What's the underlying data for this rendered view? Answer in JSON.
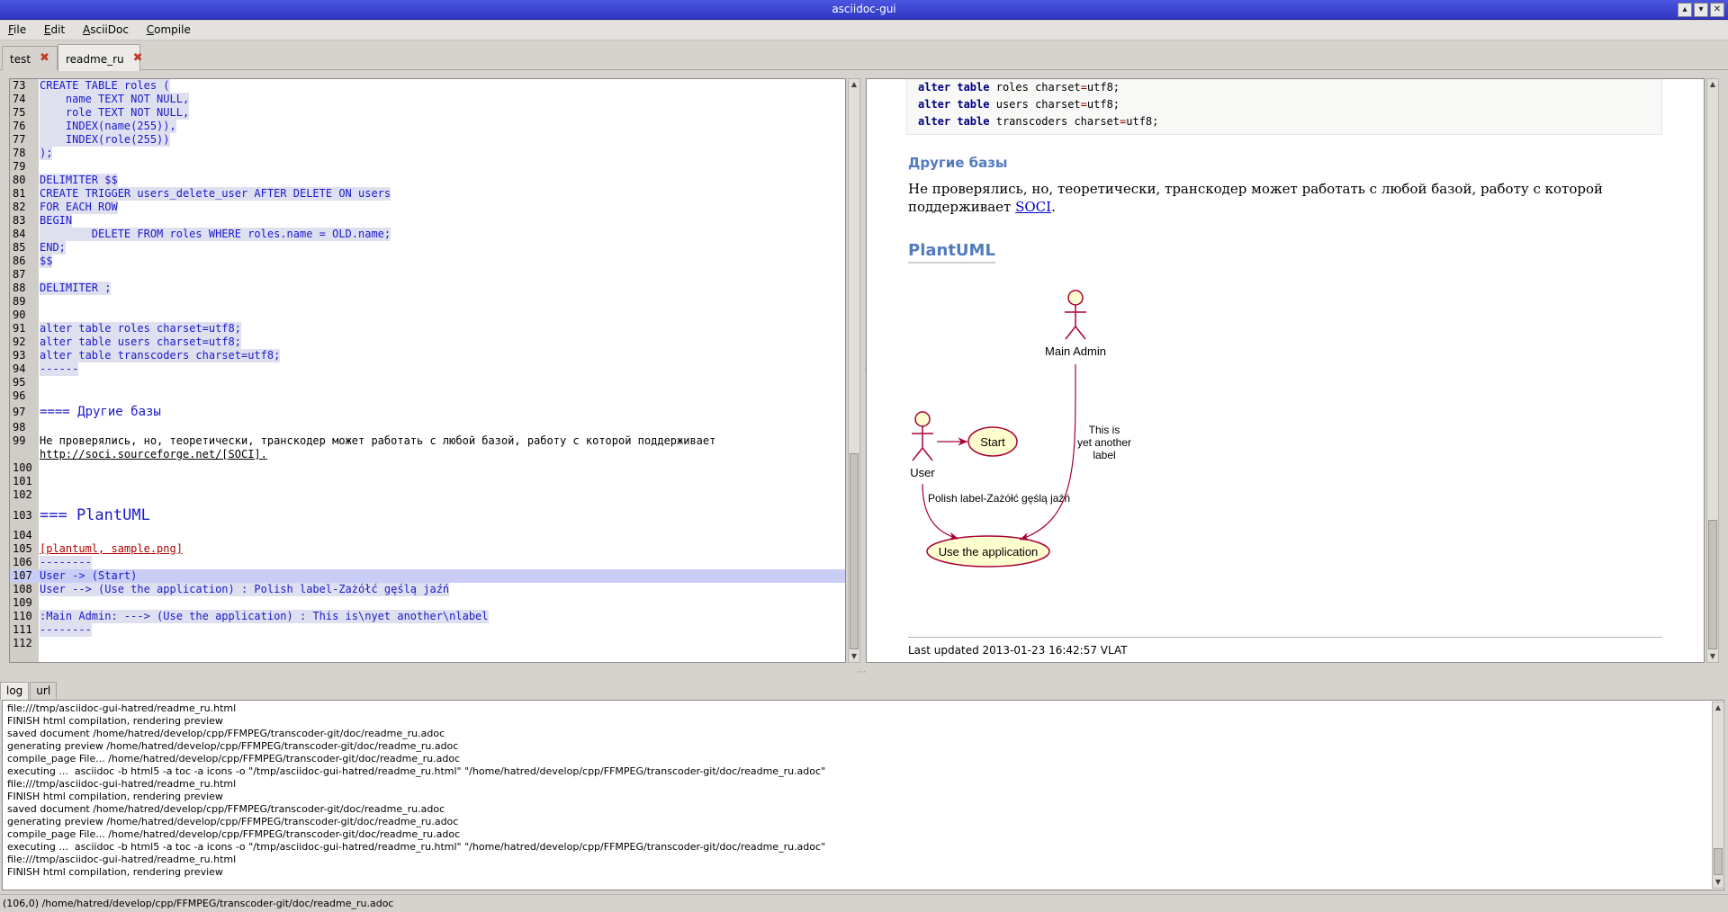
{
  "window": {
    "title": "asciidoc-gui",
    "buttons": [
      "▴",
      "▾",
      "✕"
    ]
  },
  "menu": [
    {
      "accel": "F",
      "rest": "ile"
    },
    {
      "accel": "E",
      "rest": "dit"
    },
    {
      "accel": "A",
      "rest": "sciiDoc"
    },
    {
      "accel": "C",
      "rest": "ompile"
    }
  ],
  "tabs": [
    {
      "label": "test",
      "close": "✖"
    },
    {
      "label": "readme_ru",
      "close": "✖"
    }
  ],
  "editor": {
    "lines": [
      {
        "n": "73",
        "t": "CREATE TABLE roles (",
        "c": "hl"
      },
      {
        "n": "74",
        "t": "    name TEXT NOT NULL,",
        "c": "hl"
      },
      {
        "n": "75",
        "t": "    role TEXT NOT NULL,",
        "c": "hl"
      },
      {
        "n": "76",
        "t": "    INDEX(name(255)),",
        "c": "hl"
      },
      {
        "n": "77",
        "t": "    INDEX(role(255))",
        "c": "hl"
      },
      {
        "n": "78",
        "t": ");",
        "c": "hl"
      },
      {
        "n": "79",
        "t": "",
        "c": ""
      },
      {
        "n": "80",
        "t": "DELIMITER $$",
        "c": "hl"
      },
      {
        "n": "81",
        "t": "CREATE TRIGGER users_delete_user AFTER DELETE ON users",
        "c": "hl"
      },
      {
        "n": "82",
        "t": "FOR EACH ROW",
        "c": "hl"
      },
      {
        "n": "83",
        "t": "BEGIN",
        "c": "hl"
      },
      {
        "n": "84",
        "t": "        DELETE FROM roles WHERE roles.name = OLD.name;",
        "c": "hl"
      },
      {
        "n": "85",
        "t": "END;",
        "c": "hl"
      },
      {
        "n": "86",
        "t": "$$",
        "c": "hl"
      },
      {
        "n": "87",
        "t": "",
        "c": ""
      },
      {
        "n": "88",
        "t": "DELIMITER ;",
        "c": "hl"
      },
      {
        "n": "89",
        "t": "",
        "c": ""
      },
      {
        "n": "90",
        "t": "",
        "c": ""
      },
      {
        "n": "91",
        "t": "alter table roles charset=utf8;",
        "c": "hl"
      },
      {
        "n": "92",
        "t": "alter table users charset=utf8;",
        "c": "hl"
      },
      {
        "n": "93",
        "t": "alter table transcoders charset=utf8;",
        "c": "hl"
      },
      {
        "n": "94",
        "t": "------",
        "c": "hl"
      },
      {
        "n": "95",
        "t": "",
        "c": ""
      },
      {
        "n": "96",
        "t": "",
        "c": ""
      },
      {
        "n": "97",
        "t": "==== Другие базы",
        "c": "h4"
      },
      {
        "n": "98",
        "t": "",
        "c": ""
      },
      {
        "n": "99",
        "t": "Не проверялись, но, теоретически, транскодер может работать с любой базой, работу с которой поддерживает",
        "c": ""
      },
      {
        "n": "",
        "t": "http://soci.sourceforge.net/[SOCI].",
        "c": "link"
      },
      {
        "n": "100",
        "t": "",
        "c": ""
      },
      {
        "n": "101",
        "t": "",
        "c": ""
      },
      {
        "n": "102",
        "t": "",
        "c": ""
      },
      {
        "n": "103",
        "t": "=== PlantUML",
        "c": "big"
      },
      {
        "n": "104",
        "t": "",
        "c": ""
      },
      {
        "n": "105",
        "t": "[plantuml, sample.png]",
        "c": "red"
      },
      {
        "n": "106",
        "t": "--------",
        "c": "hl"
      },
      {
        "n": "107",
        "t": "User -> (Start)",
        "c": "cur"
      },
      {
        "n": "108",
        "t": "User --> (Use the application) : Polish label-Zażółć gęślą jaźń",
        "c": "hl"
      },
      {
        "n": "109",
        "t": "",
        "c": ""
      },
      {
        "n": "110",
        "t": ":Main Admin: ---> (Use the application) : This is\\nyet another\\nlabel",
        "c": "hl"
      },
      {
        "n": "111",
        "t": "--------",
        "c": "hl"
      },
      {
        "n": "112",
        "t": "",
        "c": ""
      }
    ]
  },
  "preview": {
    "code": [
      {
        "kw1": "alter",
        "kw2": "table",
        "name": "roles",
        "rest": "charset",
        "eq": "=",
        "val": "utf8;"
      },
      {
        "kw1": "alter",
        "kw2": "table",
        "name": "users",
        "rest": "charset",
        "eq": "=",
        "val": "utf8;"
      },
      {
        "kw1": "alter",
        "kw2": "table",
        "name": "transcoders",
        "rest": "charset",
        "eq": "=",
        "val": "utf8;"
      }
    ],
    "section_title": "Другие базы",
    "paragraph_before": "Не проверялись, но, теоретически, транскодер может работать с любой базой, работу с которой поддерживает ",
    "paragraph_link": "SOCI",
    "paragraph_after": ".",
    "h3": "PlantUML",
    "diagram": {
      "actor_admin": "Main Admin",
      "actor_user": "User",
      "usecase_start": "Start",
      "usecase_app": "Use the application",
      "label_polish": "Polish label-Zażółć gęślą jaźń",
      "label_admin_1": "This is",
      "label_admin_2": "yet another",
      "label_admin_3": "label"
    },
    "footer": "Last updated 2013-01-23 16:42:57 VLAT"
  },
  "bottom_tabs": [
    "log",
    "url"
  ],
  "log": [
    "file:///tmp/asciidoc-gui-hatred/readme_ru.html",
    "FINISH html compilation, rendering preview",
    "saved document /home/hatred/develop/cpp/FFMPEG/transcoder-git/doc/readme_ru.adoc",
    "generating preview /home/hatred/develop/cpp/FFMPEG/transcoder-git/doc/readme_ru.adoc",
    "compile_page File... /home/hatred/develop/cpp/FFMPEG/transcoder-git/doc/readme_ru.adoc",
    "executing ...  asciidoc -b html5 -a toc -a icons -o \"/tmp/asciidoc-gui-hatred/readme_ru.html\" \"/home/hatred/develop/cpp/FFMPEG/transcoder-git/doc/readme_ru.adoc\"",
    "file:///tmp/asciidoc-gui-hatred/readme_ru.html",
    "FINISH html compilation, rendering preview",
    "saved document /home/hatred/develop/cpp/FFMPEG/transcoder-git/doc/readme_ru.adoc",
    "generating preview /home/hatred/develop/cpp/FFMPEG/transcoder-git/doc/readme_ru.adoc",
    "compile_page File... /home/hatred/develop/cpp/FFMPEG/transcoder-git/doc/readme_ru.adoc",
    "executing ...  asciidoc -b html5 -a toc -a icons -o \"/tmp/asciidoc-gui-hatred/readme_ru.html\" \"/home/hatred/develop/cpp/FFMPEG/transcoder-git/doc/readme_ru.adoc\"",
    "file:///tmp/asciidoc-gui-hatred/readme_ru.html",
    "FINISH html compilation, rendering preview"
  ],
  "status": "(106,0)  /home/hatred/develop/cpp/FFMPEG/transcoder-git/doc/readme_ru.adoc",
  "colors": {
    "titlebar": "#2f37c4",
    "editor_text": "#1a1acc",
    "heading": "#527bbd",
    "diagram_stroke": "#a80036",
    "diagram_fill": "#fefece"
  }
}
